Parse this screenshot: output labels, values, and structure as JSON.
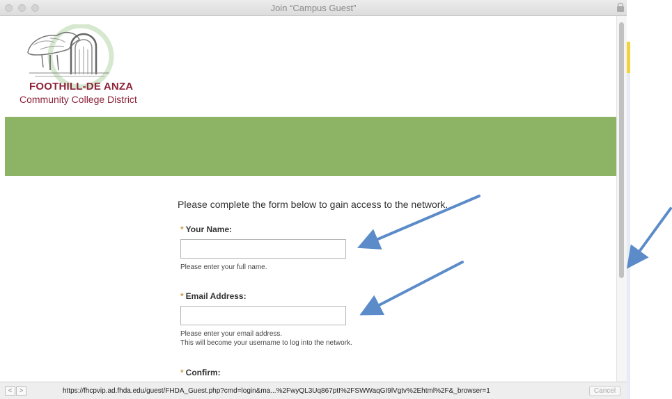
{
  "window": {
    "title": "Join “Campus Guest”"
  },
  "logo": {
    "line1": "FOOTHILL-DE ANZA",
    "line2": "Community College District"
  },
  "colors": {
    "band": "#8db364",
    "brand": "#8c2339",
    "annotation_arrow": "#5b8cc9"
  },
  "form": {
    "intro": "Please complete the form below to gain access to the network.",
    "required_marker": "*",
    "name": {
      "label": "Your Name:",
      "value": "",
      "hint": "Please enter your full name."
    },
    "email": {
      "label": "Email Address:",
      "value": "",
      "hint_line1": "Please enter your email address.",
      "hint_line2": "This will become your username to log into the network."
    },
    "confirm": {
      "label": "Confirm:"
    }
  },
  "status": {
    "back": "<",
    "forward": ">",
    "url": "https://fhcpvip.ad.fhda.edu/guest/FHDA_Guest.php?cmd=login&ma...%2FwyQL3Uq867ptI%2FSWWaqGI9lVgtv%2Ehtml%2F&_browser=1",
    "cancel": "Cancel"
  }
}
